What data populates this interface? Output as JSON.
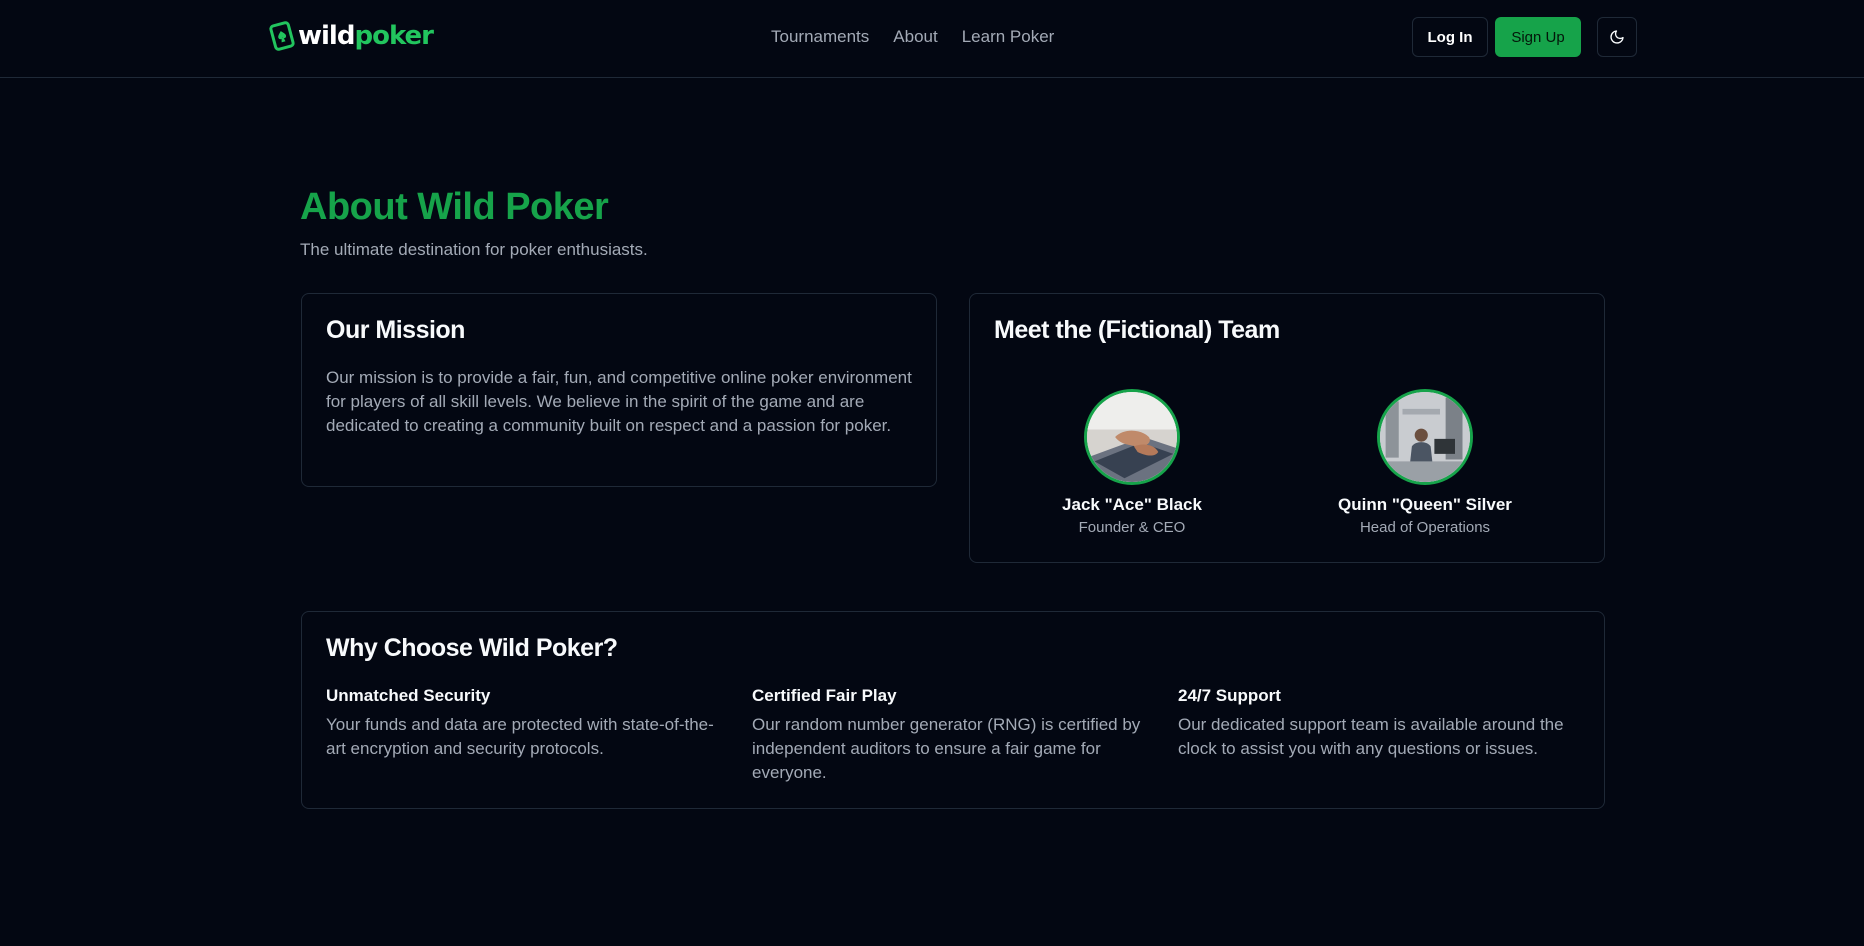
{
  "header": {
    "logo_word": "wild",
    "logo_word2": "poker",
    "nav": [
      "Tournaments",
      "About",
      "Learn Poker"
    ],
    "login_label": "Log In",
    "signup_label": "Sign Up",
    "theme_icon": "moon-icon"
  },
  "hero": {
    "title": "About Wild Poker",
    "subtitle": "The ultimate destination for poker enthusiasts."
  },
  "mission": {
    "title": "Our Mission",
    "text": "Our mission is to provide a fair, fun, and competitive online poker environment for players of all skill levels. We believe in the spirit of the game and are dedicated to creating a community built on respect and a passion for poker."
  },
  "team": {
    "title": "Meet the (Fictional) Team",
    "members": [
      {
        "name": "Jack \"Ace\" Black",
        "role": "Founder & CEO"
      },
      {
        "name": "Quinn \"Queen\" Silver",
        "role": "Head of Operations"
      }
    ]
  },
  "why": {
    "title": "Why Choose Wild Poker?",
    "features": [
      {
        "title": "Unmatched Security",
        "text": "Your funds and data are protected with state-of-the-art encryption and security protocols."
      },
      {
        "title": "Certified Fair Play",
        "text": "Our random number generator (RNG) is certified by independent auditors to ensure a fair game for everyone."
      },
      {
        "title": "24/7 Support",
        "text": "Our dedicated support team is available around the clock to assist you with any questions or issues."
      }
    ]
  },
  "colors": {
    "background": "#030712",
    "accent": "#16a34a",
    "muted_text": "#a3aab6",
    "border": "#1f2937"
  }
}
